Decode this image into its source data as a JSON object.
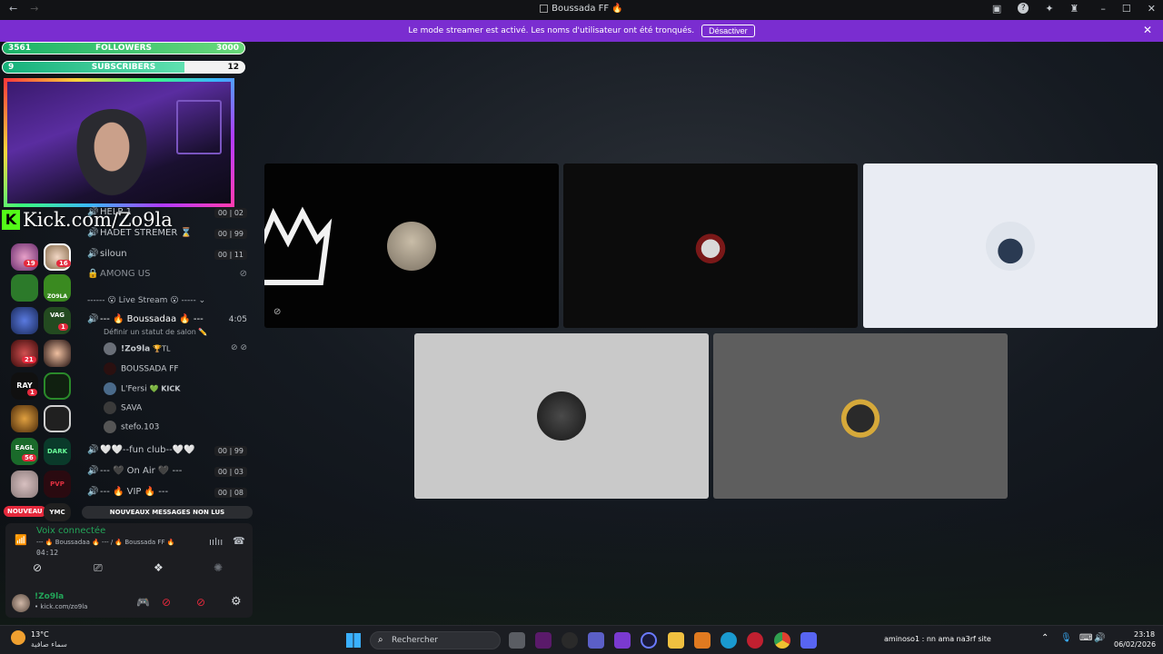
{
  "titlebar": {
    "back": "←",
    "forward": "→",
    "title": "Boussada FF",
    "title_emoji": "🔥",
    "icons": [
      "window-icon",
      "help-icon",
      "tools-icon",
      "accessibility-icon"
    ],
    "minimize": "–",
    "maximize": "☐",
    "close": "✕"
  },
  "banner": {
    "text": "Le mode streamer est activé. Les noms d'utilisateur ont été tronqués.",
    "button": "Désactiver",
    "close": "✕"
  },
  "overlay": {
    "followers_label": "FOLLOWERS",
    "followers_current": "3561",
    "followers_goal": "3000",
    "subscribers_label": "SUBSCRIBERS",
    "subscribers_current": "9",
    "subscribers_goal": "12",
    "kick_url": "Kick.com/Zo9la",
    "kick_logo": "K"
  },
  "channels": [
    {
      "name": "HELP 1",
      "count_a": "00",
      "count_b": "02",
      "icon": "🔊"
    },
    {
      "name": "HADET STREMER ⌛",
      "count_a": "00",
      "count_b": "99",
      "icon": "🔊"
    },
    {
      "name": "siloun",
      "count_a": "00",
      "count_b": "11",
      "icon": "🔊"
    },
    {
      "name": "AMONG US",
      "icon": "🔒"
    }
  ],
  "category": "------ 😮 Live Stream 😮 -----",
  "active_channel": {
    "name": "--- 🔥 Boussadaa 🔥 ---",
    "time": "4:05",
    "status": "Définir un statut de salon ✏️"
  },
  "members": [
    {
      "name": "!Zo9la",
      "tag": "🏆TL"
    },
    {
      "name": "BOUSSADA FF",
      "tag": ""
    },
    {
      "name": "L'Fersi",
      "tag": "💚 KICK"
    },
    {
      "name": "SAVA",
      "tag": ""
    },
    {
      "name": "stefo.103",
      "tag": ""
    }
  ],
  "more_channels": [
    {
      "name": "🤍🤍--fun club--🤍🤍",
      "count_a": "00",
      "count_b": "99"
    },
    {
      "name": "--- 🖤 On Air 🖤 ---",
      "count_a": "00",
      "count_b": "03"
    },
    {
      "name": "--- 🔥 VIP 🔥 ---",
      "count_a": "00",
      "count_b": "08"
    }
  ],
  "unread_banner": "NOUVEAUX MESSAGES NON LUS",
  "nouveau_label": "NOUVEAU",
  "server_badges": [
    "19",
    "16",
    "1",
    "21",
    "1",
    "56"
  ],
  "server_texts": {
    "ray": "RAY",
    "zo9la": "ZO9LA",
    "dark": "DARK",
    "vag": "VAG",
    "ymc": "YMC",
    "pvp": "PVP",
    "eagl": "EAGL"
  },
  "voice": {
    "status": "Voix connectée",
    "channel": "--- 🔥 Boussadaa 🔥 --- / 🔥 Boussada FF 🔥",
    "timer": "04:12"
  },
  "user_panel": {
    "name": "!Zo9la",
    "sub": "• kick.com/zo9la"
  },
  "taskbar": {
    "weather_temp": "13°C",
    "weather_text": "سماء صافية",
    "search_placeholder": "Rechercher",
    "notification": "aminoso1 : nn ama na3rf site",
    "time": "23:18",
    "date": "06/02/2026"
  },
  "colors": {
    "accent": "#7a2dd0",
    "green": "#23a559",
    "red": "#e4293c"
  }
}
